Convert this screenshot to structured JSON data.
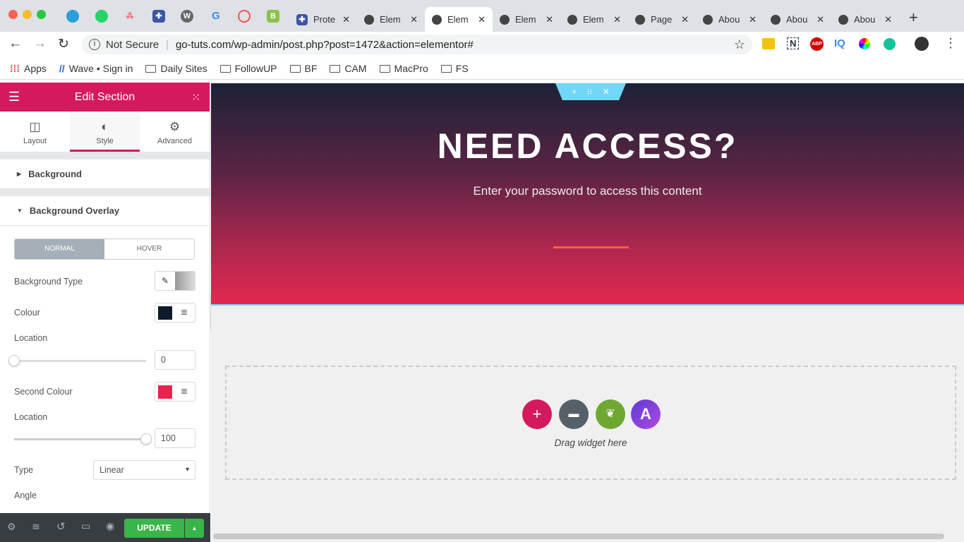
{
  "browser": {
    "pinned_icons": [
      "telegram-icon",
      "whatsapp-icon",
      "asana-icon",
      "confluence-icon",
      "wordpress-icon",
      "google-icon",
      "lastpass-icon",
      "b-icon"
    ],
    "tabs": [
      {
        "label": "Prote"
      },
      {
        "label": "Elem"
      },
      {
        "label": "Elem",
        "active": true
      },
      {
        "label": "Elem"
      },
      {
        "label": "Elem"
      },
      {
        "label": "Page"
      },
      {
        "label": "Abou"
      },
      {
        "label": "Abou"
      },
      {
        "label": "Abou"
      }
    ],
    "security": "Not Secure",
    "url": "go-tuts.com/wp-admin/post.php?post=1472&action=elementor#",
    "extensions": [
      "ABP",
      "IQ"
    ],
    "bookmarks": [
      {
        "label": "Apps"
      },
      {
        "label": "Wave • Sign in"
      },
      {
        "label": "Daily Sites"
      },
      {
        "label": "FollowUP"
      },
      {
        "label": "BF"
      },
      {
        "label": "CAM"
      },
      {
        "label": "MacPro"
      },
      {
        "label": "FS"
      }
    ]
  },
  "panel": {
    "title": "Edit Section",
    "tabs": [
      {
        "label": "Layout"
      },
      {
        "label": "Style"
      },
      {
        "label": "Advanced"
      }
    ],
    "sections": {
      "background": "Background",
      "overlay": "Background Overlay"
    },
    "state_tabs": {
      "normal": "NORMAL",
      "hover": "HOVER"
    },
    "fields": {
      "bg_type": "Background Type",
      "colour": "Colour",
      "colour_value": "#0d1b2a",
      "location": "Location",
      "location_value": "0",
      "second_colour": "Second Colour",
      "second_colour_value": "#e8234f",
      "location2": "Location",
      "location2_value": "100",
      "type": "Type",
      "type_value": "Linear",
      "angle": "Angle"
    },
    "footer": {
      "update": "UPDATE"
    }
  },
  "canvas": {
    "heading": "NEED ACCESS?",
    "subheading": "Enter your password to access this content",
    "divider_color": "#f0643c",
    "drop_text": "Drag widget here"
  },
  "colors": {
    "accent": "#d5195e",
    "update": "#39b54a"
  }
}
